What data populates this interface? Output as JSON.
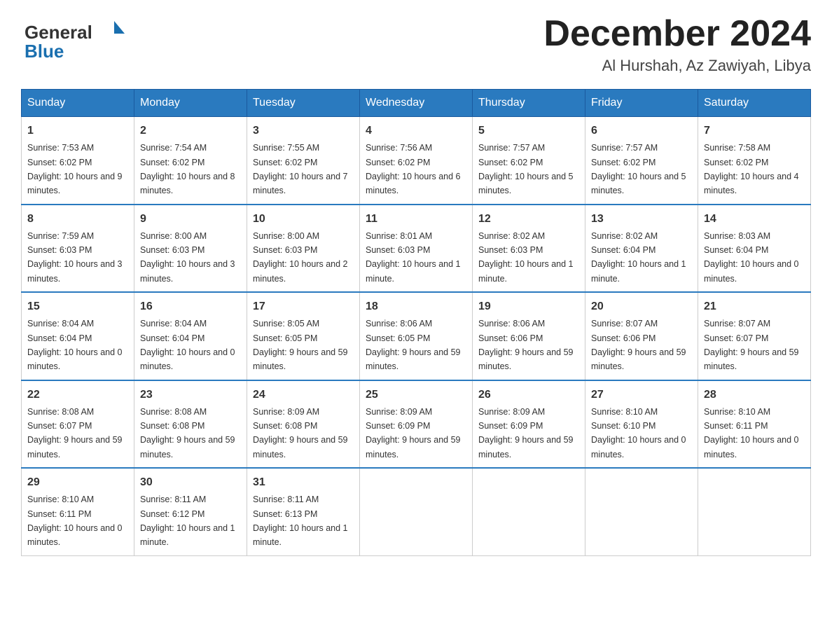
{
  "header": {
    "logo_general": "General",
    "logo_blue": "Blue",
    "month_title": "December 2024",
    "location": "Al Hurshah, Az Zawiyah, Libya"
  },
  "days_of_week": [
    "Sunday",
    "Monday",
    "Tuesday",
    "Wednesday",
    "Thursday",
    "Friday",
    "Saturday"
  ],
  "weeks": [
    [
      {
        "day": "1",
        "sunrise": "7:53 AM",
        "sunset": "6:02 PM",
        "daylight": "10 hours and 9 minutes."
      },
      {
        "day": "2",
        "sunrise": "7:54 AM",
        "sunset": "6:02 PM",
        "daylight": "10 hours and 8 minutes."
      },
      {
        "day": "3",
        "sunrise": "7:55 AM",
        "sunset": "6:02 PM",
        "daylight": "10 hours and 7 minutes."
      },
      {
        "day": "4",
        "sunrise": "7:56 AM",
        "sunset": "6:02 PM",
        "daylight": "10 hours and 6 minutes."
      },
      {
        "day": "5",
        "sunrise": "7:57 AM",
        "sunset": "6:02 PM",
        "daylight": "10 hours and 5 minutes."
      },
      {
        "day": "6",
        "sunrise": "7:57 AM",
        "sunset": "6:02 PM",
        "daylight": "10 hours and 5 minutes."
      },
      {
        "day": "7",
        "sunrise": "7:58 AM",
        "sunset": "6:02 PM",
        "daylight": "10 hours and 4 minutes."
      }
    ],
    [
      {
        "day": "8",
        "sunrise": "7:59 AM",
        "sunset": "6:03 PM",
        "daylight": "10 hours and 3 minutes."
      },
      {
        "day": "9",
        "sunrise": "8:00 AM",
        "sunset": "6:03 PM",
        "daylight": "10 hours and 3 minutes."
      },
      {
        "day": "10",
        "sunrise": "8:00 AM",
        "sunset": "6:03 PM",
        "daylight": "10 hours and 2 minutes."
      },
      {
        "day": "11",
        "sunrise": "8:01 AM",
        "sunset": "6:03 PM",
        "daylight": "10 hours and 1 minute."
      },
      {
        "day": "12",
        "sunrise": "8:02 AM",
        "sunset": "6:03 PM",
        "daylight": "10 hours and 1 minute."
      },
      {
        "day": "13",
        "sunrise": "8:02 AM",
        "sunset": "6:04 PM",
        "daylight": "10 hours and 1 minute."
      },
      {
        "day": "14",
        "sunrise": "8:03 AM",
        "sunset": "6:04 PM",
        "daylight": "10 hours and 0 minutes."
      }
    ],
    [
      {
        "day": "15",
        "sunrise": "8:04 AM",
        "sunset": "6:04 PM",
        "daylight": "10 hours and 0 minutes."
      },
      {
        "day": "16",
        "sunrise": "8:04 AM",
        "sunset": "6:04 PM",
        "daylight": "10 hours and 0 minutes."
      },
      {
        "day": "17",
        "sunrise": "8:05 AM",
        "sunset": "6:05 PM",
        "daylight": "9 hours and 59 minutes."
      },
      {
        "day": "18",
        "sunrise": "8:06 AM",
        "sunset": "6:05 PM",
        "daylight": "9 hours and 59 minutes."
      },
      {
        "day": "19",
        "sunrise": "8:06 AM",
        "sunset": "6:06 PM",
        "daylight": "9 hours and 59 minutes."
      },
      {
        "day": "20",
        "sunrise": "8:07 AM",
        "sunset": "6:06 PM",
        "daylight": "9 hours and 59 minutes."
      },
      {
        "day": "21",
        "sunrise": "8:07 AM",
        "sunset": "6:07 PM",
        "daylight": "9 hours and 59 minutes."
      }
    ],
    [
      {
        "day": "22",
        "sunrise": "8:08 AM",
        "sunset": "6:07 PM",
        "daylight": "9 hours and 59 minutes."
      },
      {
        "day": "23",
        "sunrise": "8:08 AM",
        "sunset": "6:08 PM",
        "daylight": "9 hours and 59 minutes."
      },
      {
        "day": "24",
        "sunrise": "8:09 AM",
        "sunset": "6:08 PM",
        "daylight": "9 hours and 59 minutes."
      },
      {
        "day": "25",
        "sunrise": "8:09 AM",
        "sunset": "6:09 PM",
        "daylight": "9 hours and 59 minutes."
      },
      {
        "day": "26",
        "sunrise": "8:09 AM",
        "sunset": "6:09 PM",
        "daylight": "9 hours and 59 minutes."
      },
      {
        "day": "27",
        "sunrise": "8:10 AM",
        "sunset": "6:10 PM",
        "daylight": "10 hours and 0 minutes."
      },
      {
        "day": "28",
        "sunrise": "8:10 AM",
        "sunset": "6:11 PM",
        "daylight": "10 hours and 0 minutes."
      }
    ],
    [
      {
        "day": "29",
        "sunrise": "8:10 AM",
        "sunset": "6:11 PM",
        "daylight": "10 hours and 0 minutes."
      },
      {
        "day": "30",
        "sunrise": "8:11 AM",
        "sunset": "6:12 PM",
        "daylight": "10 hours and 1 minute."
      },
      {
        "day": "31",
        "sunrise": "8:11 AM",
        "sunset": "6:13 PM",
        "daylight": "10 hours and 1 minute."
      },
      null,
      null,
      null,
      null
    ]
  ],
  "labels": {
    "sunrise": "Sunrise:",
    "sunset": "Sunset:",
    "daylight": "Daylight:"
  }
}
